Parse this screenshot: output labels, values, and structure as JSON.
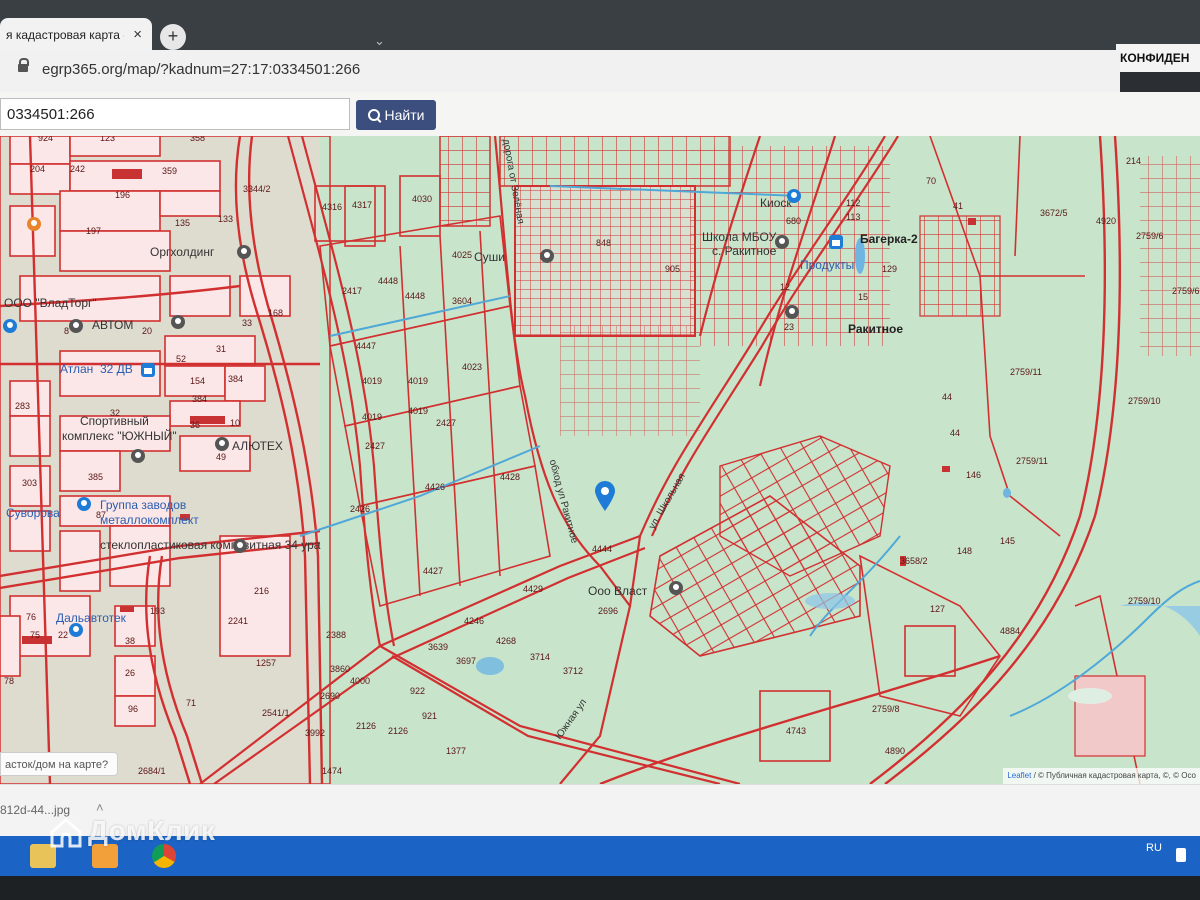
{
  "browser": {
    "tab_title": "я кадастровая карта -",
    "tab_close": "×",
    "new_tab": "+",
    "address_url": "egrp365.org/map/?kadnum=27:17:0334501:266",
    "side_badge": "КОНФИДЕН"
  },
  "search": {
    "input_value": "0334501:266",
    "button_label": "Найти"
  },
  "map": {
    "address_hint": "асток/дом на карте?",
    "attribution_leaflet": "Leaflet",
    "attribution_rest": " / © Публичная кадастровая карта, ©, © Осо",
    "places": {
      "bagerka": "Багерка-2",
      "rakitnoe": "Ракитное",
      "produkty": "Продукты",
      "orgkholding": "Оргхолдинг",
      "vladtorg": "ООО \"ВладТорг\"",
      "avtom": "АВТОМ",
      "atlan": "Атлан",
      "dv": "32 ДВ",
      "sport1": "Спортивный",
      "sport2": "комплекс \"ЮЖНЫЙ\"",
      "alyuteh": "АЛЮТЕХ",
      "gruppa1": "Группа заводов",
      "gruppa2": "металлокомплект",
      "steklo": "стеклопластиковая композитная 34 ура",
      "dalavtotek": "Дальавтотек",
      "suvorova": "Суворова",
      "mbou": "Школа МБОУ",
      "rakitnoe_s": "с. Ракитное",
      "sushi": "Суши",
      "road1": "ул. Школьная",
      "road2": "дорога от Зелёная",
      "road3": "Южная ул",
      "road4": "обход ул Ракитное",
      "kiosk": "Киоск",
      "oooblast": "Ооо Власт"
    },
    "parcels": [
      "924",
      "123",
      "358",
      "204",
      "242",
      "359",
      "196",
      "135",
      "197",
      "133",
      "3344/2",
      "4316",
      "4317",
      "4030",
      "4025",
      "4448",
      "4448",
      "3604",
      "2417",
      "4447",
      "4019",
      "4019",
      "4023",
      "4019",
      "4019",
      "2427",
      "2427",
      "4426",
      "4428",
      "2426",
      "4427",
      "4429",
      "4444",
      "2696",
      "4246",
      "4268",
      "3639",
      "3697",
      "3714",
      "3712",
      "922",
      "921",
      "1377",
      "1474",
      "2126",
      "2126",
      "3992",
      "2684/1",
      "2541/1",
      "3860",
      "2388",
      "4000",
      "2690",
      "905",
      "848",
      "4743",
      "2759/8",
      "4884",
      "4890",
      "2759/10",
      "2759/11",
      "2759/11",
      "2759/10",
      "2759/6",
      "3672/5",
      "4920",
      "41",
      "70",
      "44",
      "44",
      "146",
      "148",
      "145",
      "127",
      "3658/2",
      "112",
      "113",
      "680",
      "129",
      "23",
      "52",
      "31",
      "154",
      "384",
      "384",
      "36",
      "10",
      "38",
      "283",
      "303",
      "385",
      "87",
      "76",
      "75",
      "22",
      "78",
      "26",
      "96",
      "71",
      "216",
      "2241",
      "1257",
      "193",
      "49",
      "32",
      "33",
      "168",
      "8",
      "20",
      "15",
      "12",
      "214",
      "2759/6"
    ]
  },
  "downloads": {
    "file": "812d-44...jpg",
    "chevron": "˄"
  },
  "taskbar": {
    "lang": "RU"
  },
  "watermark": {
    "text": "ДомКлик"
  },
  "colors": {
    "map_bg": "#c8e4cb",
    "parcel_line": "#d23030",
    "water": "#4fa8d8",
    "button": "#3b4e7e",
    "taskbar": "#1b63c4",
    "pin": "#1e7bd6"
  }
}
